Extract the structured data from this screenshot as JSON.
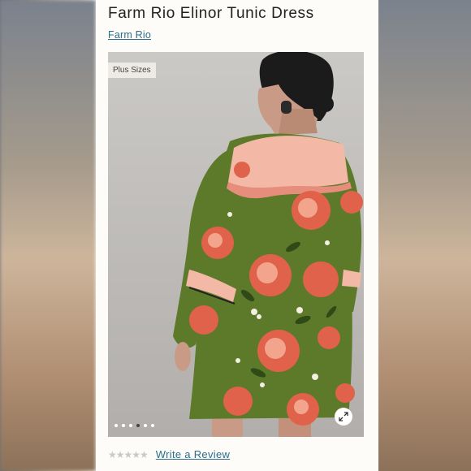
{
  "product": {
    "title": "Farm Rio Elinor Tunic Dress",
    "brand": "Farm Rio"
  },
  "image": {
    "badge": "Plus Sizes",
    "carousel_count": 6,
    "carousel_active": 4,
    "zoom_icon": "expand-arrows-icon"
  },
  "reviews": {
    "stars_display": "★★★★★",
    "rating_stars": 0,
    "write_label": "Write a Review"
  },
  "colors": {
    "link": "#2a6f8c",
    "dress_green": "#5c7a2a",
    "flower_coral": "#e0624a",
    "yoke_pink": "#f3b8a6"
  }
}
